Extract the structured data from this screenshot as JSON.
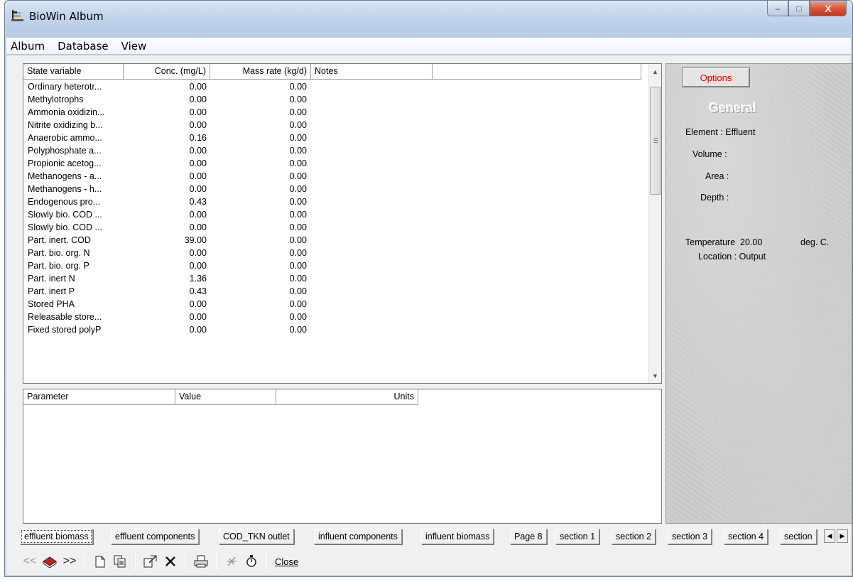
{
  "window": {
    "title": "BioWin Album",
    "min_glyph": "–",
    "max_glyph": "□",
    "close_glyph": "X"
  },
  "menu": [
    "Album",
    "Database",
    "View"
  ],
  "state_table": {
    "columns": [
      "State variable",
      "Conc. (mg/L)",
      "Mass rate (kg/d)",
      "Notes"
    ],
    "rows": [
      [
        "Ordinary heterotr...",
        "0.00",
        "0.00"
      ],
      [
        "Methylotrophs",
        "0.00",
        "0.00"
      ],
      [
        "Ammonia oxidizin...",
        "0.00",
        "0.00"
      ],
      [
        "Nitrite oxidizing b...",
        "0.00",
        "0.00"
      ],
      [
        "Anaerobic ammo...",
        "0.16",
        "0.00"
      ],
      [
        "Polyphosphate a...",
        "0.00",
        "0.00"
      ],
      [
        "Propionic acetog...",
        "0.00",
        "0.00"
      ],
      [
        "Methanogens - a...",
        "0.00",
        "0.00"
      ],
      [
        "Methanogens - h...",
        "0.00",
        "0.00"
      ],
      [
        "Endogenous pro...",
        "0.43",
        "0.00"
      ],
      [
        "Slowly bio. COD ...",
        "0.00",
        "0.00"
      ],
      [
        "Slowly bio. COD ...",
        "0.00",
        "0.00"
      ],
      [
        "Part. inert. COD",
        "39.00",
        "0.00"
      ],
      [
        "Part. bio. org. N",
        "0.00",
        "0.00"
      ],
      [
        "Part. bio. org. P",
        "0.00",
        "0.00"
      ],
      [
        "Part. inert N",
        "1.36",
        "0.00"
      ],
      [
        "Part. inert P",
        "0.43",
        "0.00"
      ],
      [
        "Stored PHA",
        "0.00",
        "0.00"
      ],
      [
        "Releasable store...",
        "0.00",
        "0.00"
      ],
      [
        "Fixed stored polyP",
        "0.00",
        "0.00"
      ]
    ]
  },
  "param_table": {
    "columns": [
      "Parameter",
      "Value",
      "Units"
    ]
  },
  "panel": {
    "options_label": "Options",
    "section_title": "General",
    "element": "Element : Effluent",
    "volume": "Volume :",
    "area": "Area :",
    "depth": "Depth :",
    "temperature_label": "Temperature",
    "temperature_value": "20.00",
    "temperature_unit": "deg. C.",
    "location": "Location : Output"
  },
  "tabs": [
    "effluent biomass",
    "effluent components",
    "COD_TKN outlet",
    "influent components",
    "influent biomass",
    "Page 8",
    "section 1",
    "section 2",
    "section 3",
    "section 4",
    "section"
  ],
  "active_tab": "effluent biomass",
  "toolbar": {
    "prev_glyph": "<<",
    "next_glyph": ">>",
    "close_label": "Close"
  },
  "icons": {
    "prev": "prev-arrows-icon",
    "album": "album-icon",
    "next": "next-arrows-icon",
    "new": "new-page-icon",
    "copy": "copy-icon",
    "properties": "properties-icon",
    "delete": "delete-icon",
    "print": "print-icon",
    "disabled_tool": "tool-disabled-icon",
    "timer": "stopwatch-icon"
  }
}
